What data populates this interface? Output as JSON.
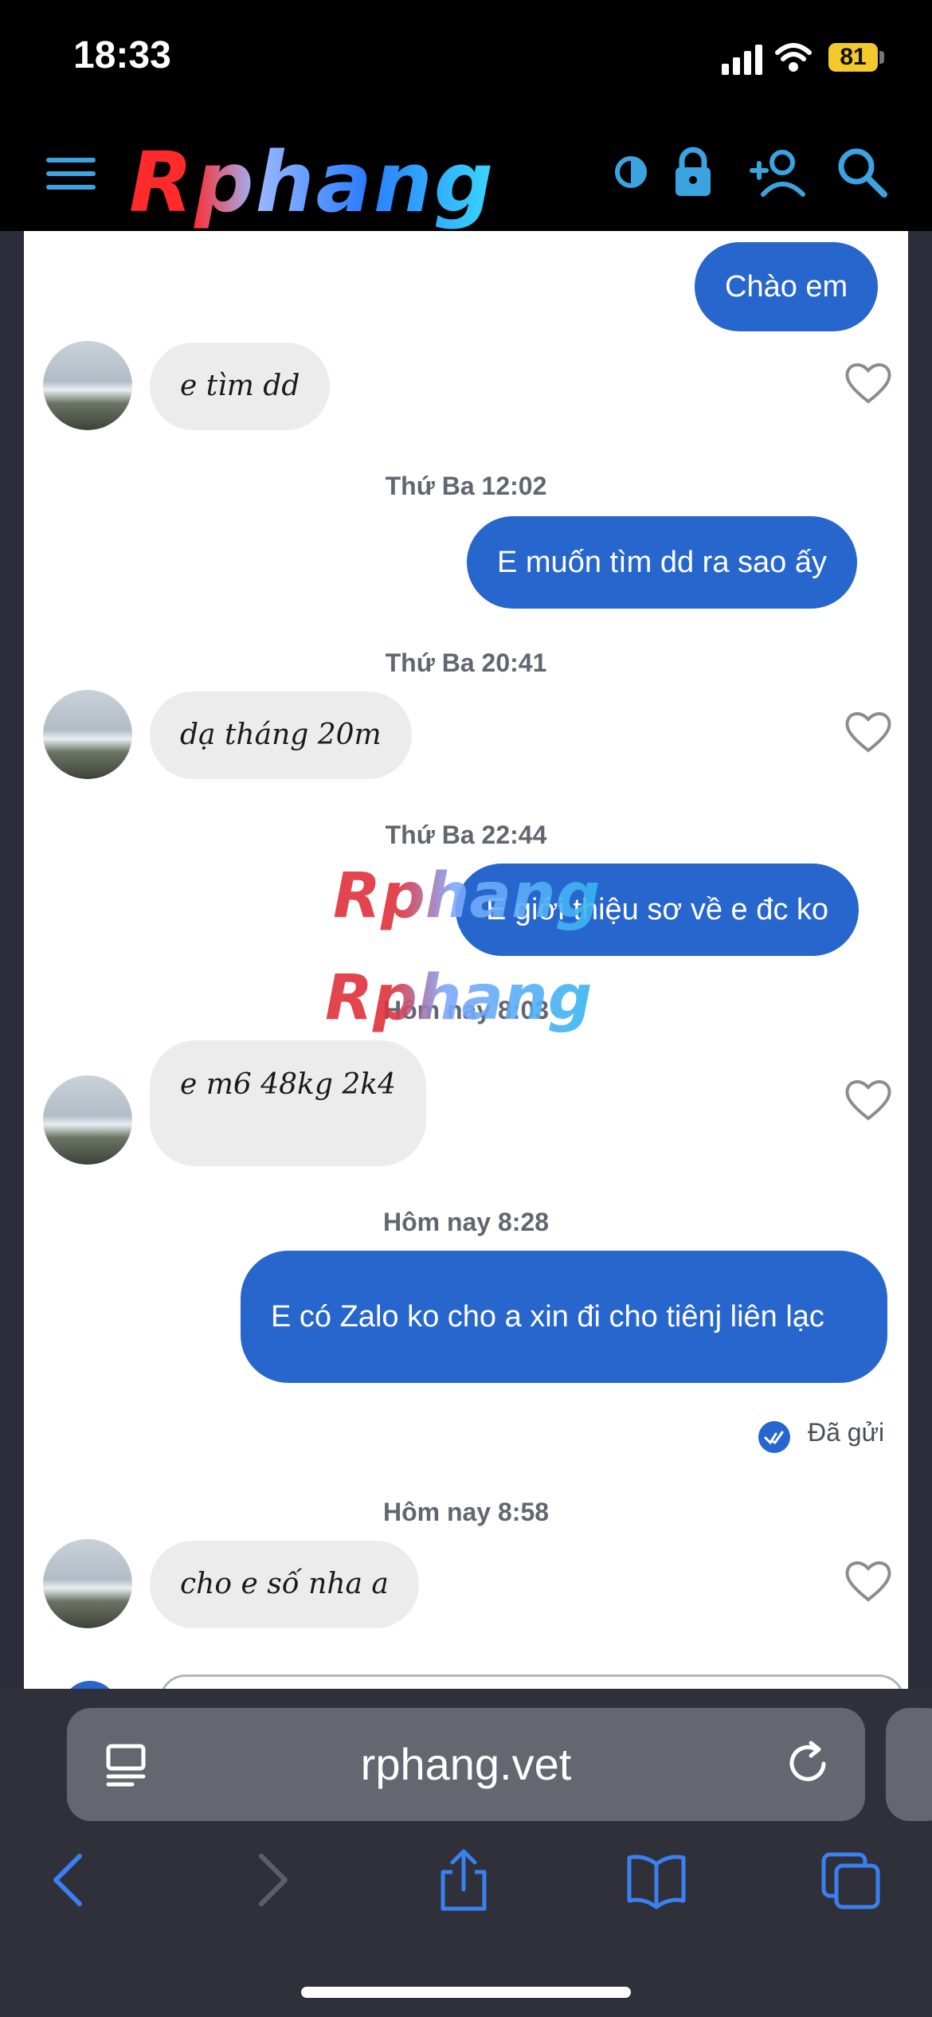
{
  "status_bar": {
    "time": "18:33",
    "battery": "81"
  },
  "site": {
    "logo_text": "Rphang"
  },
  "chat": {
    "messages": [
      {
        "dir": "out",
        "text": "Chào em"
      },
      {
        "dir": "in",
        "text": "e tìm dd"
      },
      {
        "dir": "stamp",
        "text": "Thứ Ba 12:02"
      },
      {
        "dir": "out",
        "text": "E muốn tìm dd ra sao ấy"
      },
      {
        "dir": "stamp",
        "text": "Thứ Ba 20:41"
      },
      {
        "dir": "in",
        "text": "dạ tháng 20m"
      },
      {
        "dir": "stamp",
        "text": "Thứ Ba 22:44"
      },
      {
        "dir": "out",
        "text": "E giới thiệu sơ về e đc ko"
      },
      {
        "dir": "stamp",
        "text": "Hôm nay 8:03"
      },
      {
        "dir": "in",
        "text": "e m6 48kg 2k4"
      },
      {
        "dir": "stamp",
        "text": "Hôm nay 8:28"
      },
      {
        "dir": "out",
        "text": "E có Zalo ko cho a xin đi cho tiênj liên lạc"
      },
      {
        "dir": "stamp",
        "text": "Hôm nay 8:58"
      },
      {
        "dir": "in",
        "text": "cho e số nha a"
      }
    ],
    "sent_status": "Đã gửi",
    "watermark_text": "Rphang"
  },
  "browser": {
    "url": "rphang.vet"
  }
}
